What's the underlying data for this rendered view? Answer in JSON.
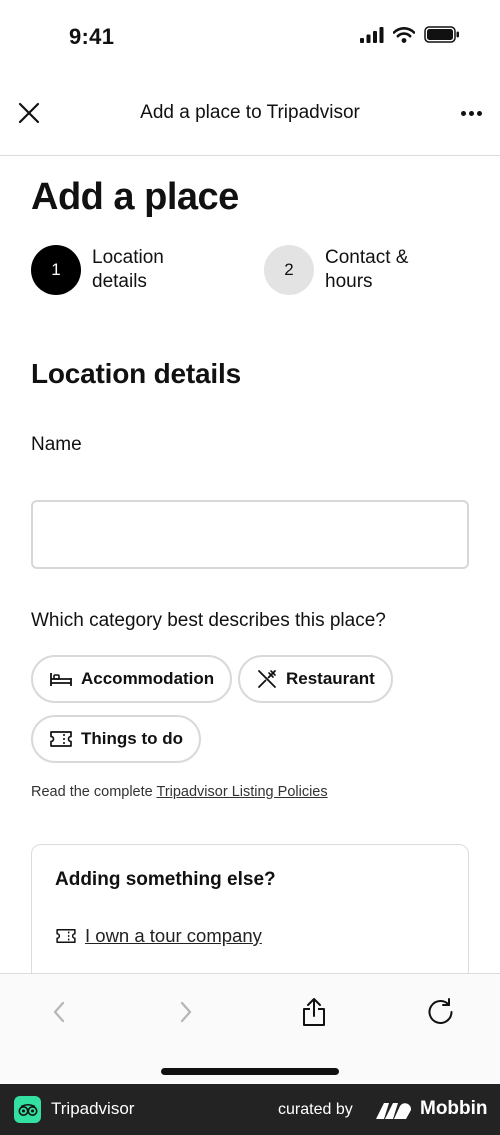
{
  "status_bar": {
    "time": "9:41"
  },
  "nav": {
    "title": "Add a place to Tripadvisor"
  },
  "page": {
    "title": "Add a place"
  },
  "steps": [
    {
      "number": "1",
      "label": "Location\ndetails",
      "state": "active"
    },
    {
      "number": "2",
      "label": "Contact &\nhours",
      "state": "inactive"
    }
  ],
  "location_section": {
    "title": "Location details",
    "name_label": "Name",
    "name_value": "",
    "category_question": "Which category best describes this place?",
    "categories": [
      {
        "label": "Accommodation",
        "icon": "bed-icon"
      },
      {
        "label": "Restaurant",
        "icon": "utensils-icon"
      },
      {
        "label": "Things to do",
        "icon": "ticket-icon"
      }
    ],
    "policy_prefix": "Read the complete",
    "policy_link": "Tripadvisor Listing Policies"
  },
  "else_card": {
    "title": "Adding something else?",
    "link": "I own a tour company",
    "link_icon": "ticket-icon"
  },
  "footer": {
    "app_name": "Tripadvisor",
    "curated_by": "curated by",
    "brand": "Mobbin"
  },
  "colors": {
    "accent": "#000000",
    "step_inactive": "#e3e3e3",
    "tripadvisor_green": "#34e0a1",
    "footer_bg": "#232323"
  }
}
